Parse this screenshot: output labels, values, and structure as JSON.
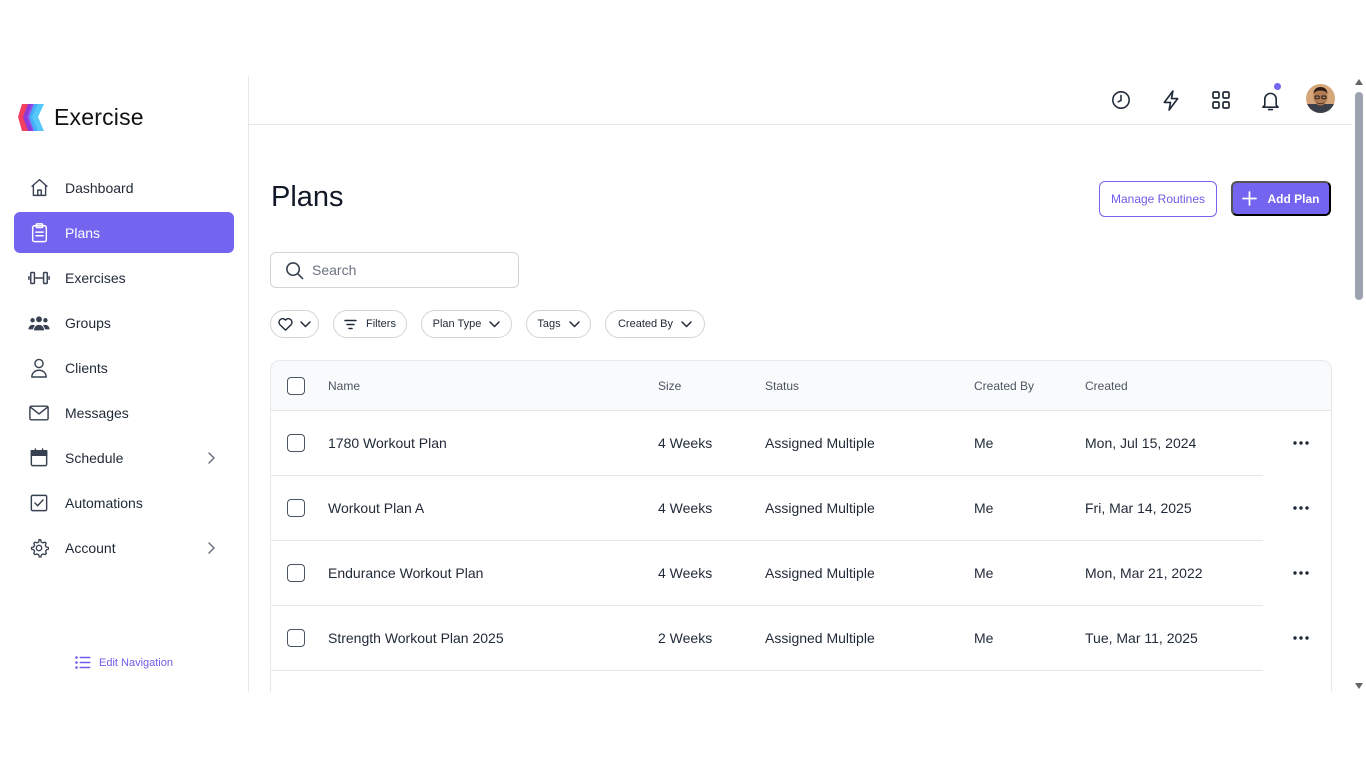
{
  "brand": {
    "name": "Exercise"
  },
  "sidebar": {
    "items": [
      {
        "label": "Dashboard",
        "icon": "home-icon"
      },
      {
        "label": "Plans",
        "icon": "clipboard-icon",
        "active": true
      },
      {
        "label": "Exercises",
        "icon": "dumbbell-icon"
      },
      {
        "label": "Groups",
        "icon": "users-icon"
      },
      {
        "label": "Clients",
        "icon": "user-icon"
      },
      {
        "label": "Messages",
        "icon": "mail-icon"
      },
      {
        "label": "Schedule",
        "icon": "calendar-icon",
        "has_submenu": true
      },
      {
        "label": "Automations",
        "icon": "check-square-icon"
      },
      {
        "label": "Account",
        "icon": "gear-icon",
        "has_submenu": true
      }
    ],
    "edit_navigation": "Edit Navigation"
  },
  "topbar": {
    "icons": [
      "clock-icon",
      "lightning-icon",
      "apps-grid-icon",
      "bell-icon"
    ],
    "has_notification": true
  },
  "main": {
    "title": "Plans",
    "manage_routines": "Manage Routines",
    "add_plan": "Add Plan",
    "search": {
      "placeholder": "Search",
      "value": ""
    },
    "filters": {
      "favorites": "",
      "filters": "Filters",
      "plan_type": "Plan Type",
      "tags": "Tags",
      "created_by": "Created By"
    },
    "table": {
      "columns": [
        "Name",
        "Size",
        "Status",
        "Created By",
        "Created"
      ],
      "rows": [
        {
          "name": "1780 Workout Plan",
          "size": "4 Weeks",
          "status": "Assigned Multiple",
          "created_by": "Me",
          "created": "Mon, Jul 15, 2024"
        },
        {
          "name": "Workout Plan A",
          "size": "4 Weeks",
          "status": "Assigned Multiple",
          "created_by": "Me",
          "created": "Fri, Mar 14, 2025"
        },
        {
          "name": "Endurance Workout Plan",
          "size": "4 Weeks",
          "status": "Assigned Multiple",
          "created_by": "Me",
          "created": "Mon, Mar 21, 2022"
        },
        {
          "name": "Strength Workout Plan 2025",
          "size": "2 Weeks",
          "status": "Assigned Multiple",
          "created_by": "Me",
          "created": "Tue, Mar 11, 2025"
        }
      ]
    }
  },
  "colors": {
    "accent": "#7465f0",
    "border": "#e5e7eb",
    "text": "#1f2937"
  }
}
